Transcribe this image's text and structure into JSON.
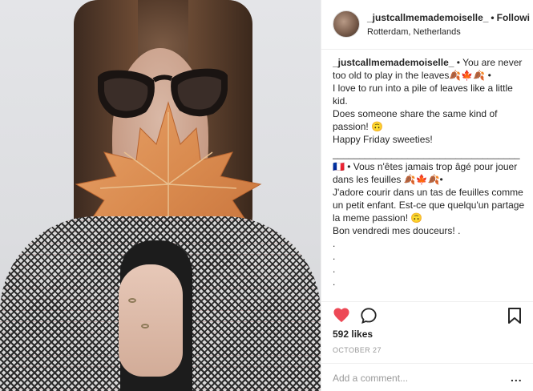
{
  "post": {
    "username": "_justcallmemademoiselle_",
    "follow_separator": "•",
    "follow_label": "Followi",
    "location": "Rotterdam, Netherlands"
  },
  "caption": {
    "author": "_justcallmemademoiselle_",
    "lines": [
      "• You are never too old to play in the leaves🍂🍁🍂 •",
      "I love to run into a pile of leaves like a little kid.",
      "Does someone share the same kind of passion! 🙃",
      "Happy Friday sweeties!",
      "___________________________________",
      "🇫🇷 • Vous n'êtes jamais trop âgé pour jouer dans les feuilles 🍂🍁🍂•",
      "J'adore courir dans un tas de feuilles comme un petit enfant. Est-ce que quelqu'un partage la meme passion! 🙃",
      "Bon vendredi mes douceurs! .",
      ".",
      ".",
      ".",
      ".",
      "."
    ]
  },
  "actions": {
    "like_icon": "heart-icon",
    "comment_icon": "comment-icon",
    "save_icon": "bookmark-icon",
    "like_color": "#ed4956"
  },
  "likes": "592 likes",
  "date": "OCTOBER 27",
  "comment": {
    "placeholder": "Add a comment...",
    "more_label": "..."
  }
}
